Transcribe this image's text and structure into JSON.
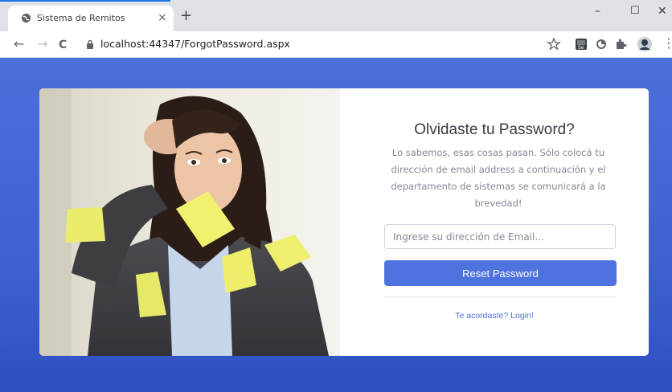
{
  "browser": {
    "tab_title": "Sistema de Remitos",
    "tab_close": "×",
    "new_tab": "+",
    "url": "localhost:44347/ForgotPassword.aspx",
    "window_minimize": "–",
    "window_maximize": "☐",
    "window_close": "✕",
    "nav_back": "←",
    "nav_forward": "→",
    "nav_reload": "C",
    "more_menu": "⋮",
    "icons": [
      "globe-icon",
      "lock-icon",
      "star-icon",
      "selenium-extension-icon",
      "circle-extension-icon",
      "puzzle-extensions-icon",
      "profile-avatar-icon"
    ]
  },
  "form": {
    "title": "Olvidaste tu Password?",
    "description": "Lo sabemos, esas cosas pasan. Sólo colocá tu dirección de email address a continuación y el departamento de sistemas se comunicará a la brevedad!",
    "email_placeholder": "Ingrese su dirección de Email...",
    "reset_button": "Reset Password",
    "login_link": "Te acordaste? Login!"
  },
  "colors": {
    "page_background": "#4e73df",
    "primary_button": "#4e73df",
    "sticky_note": "#f1f170"
  }
}
